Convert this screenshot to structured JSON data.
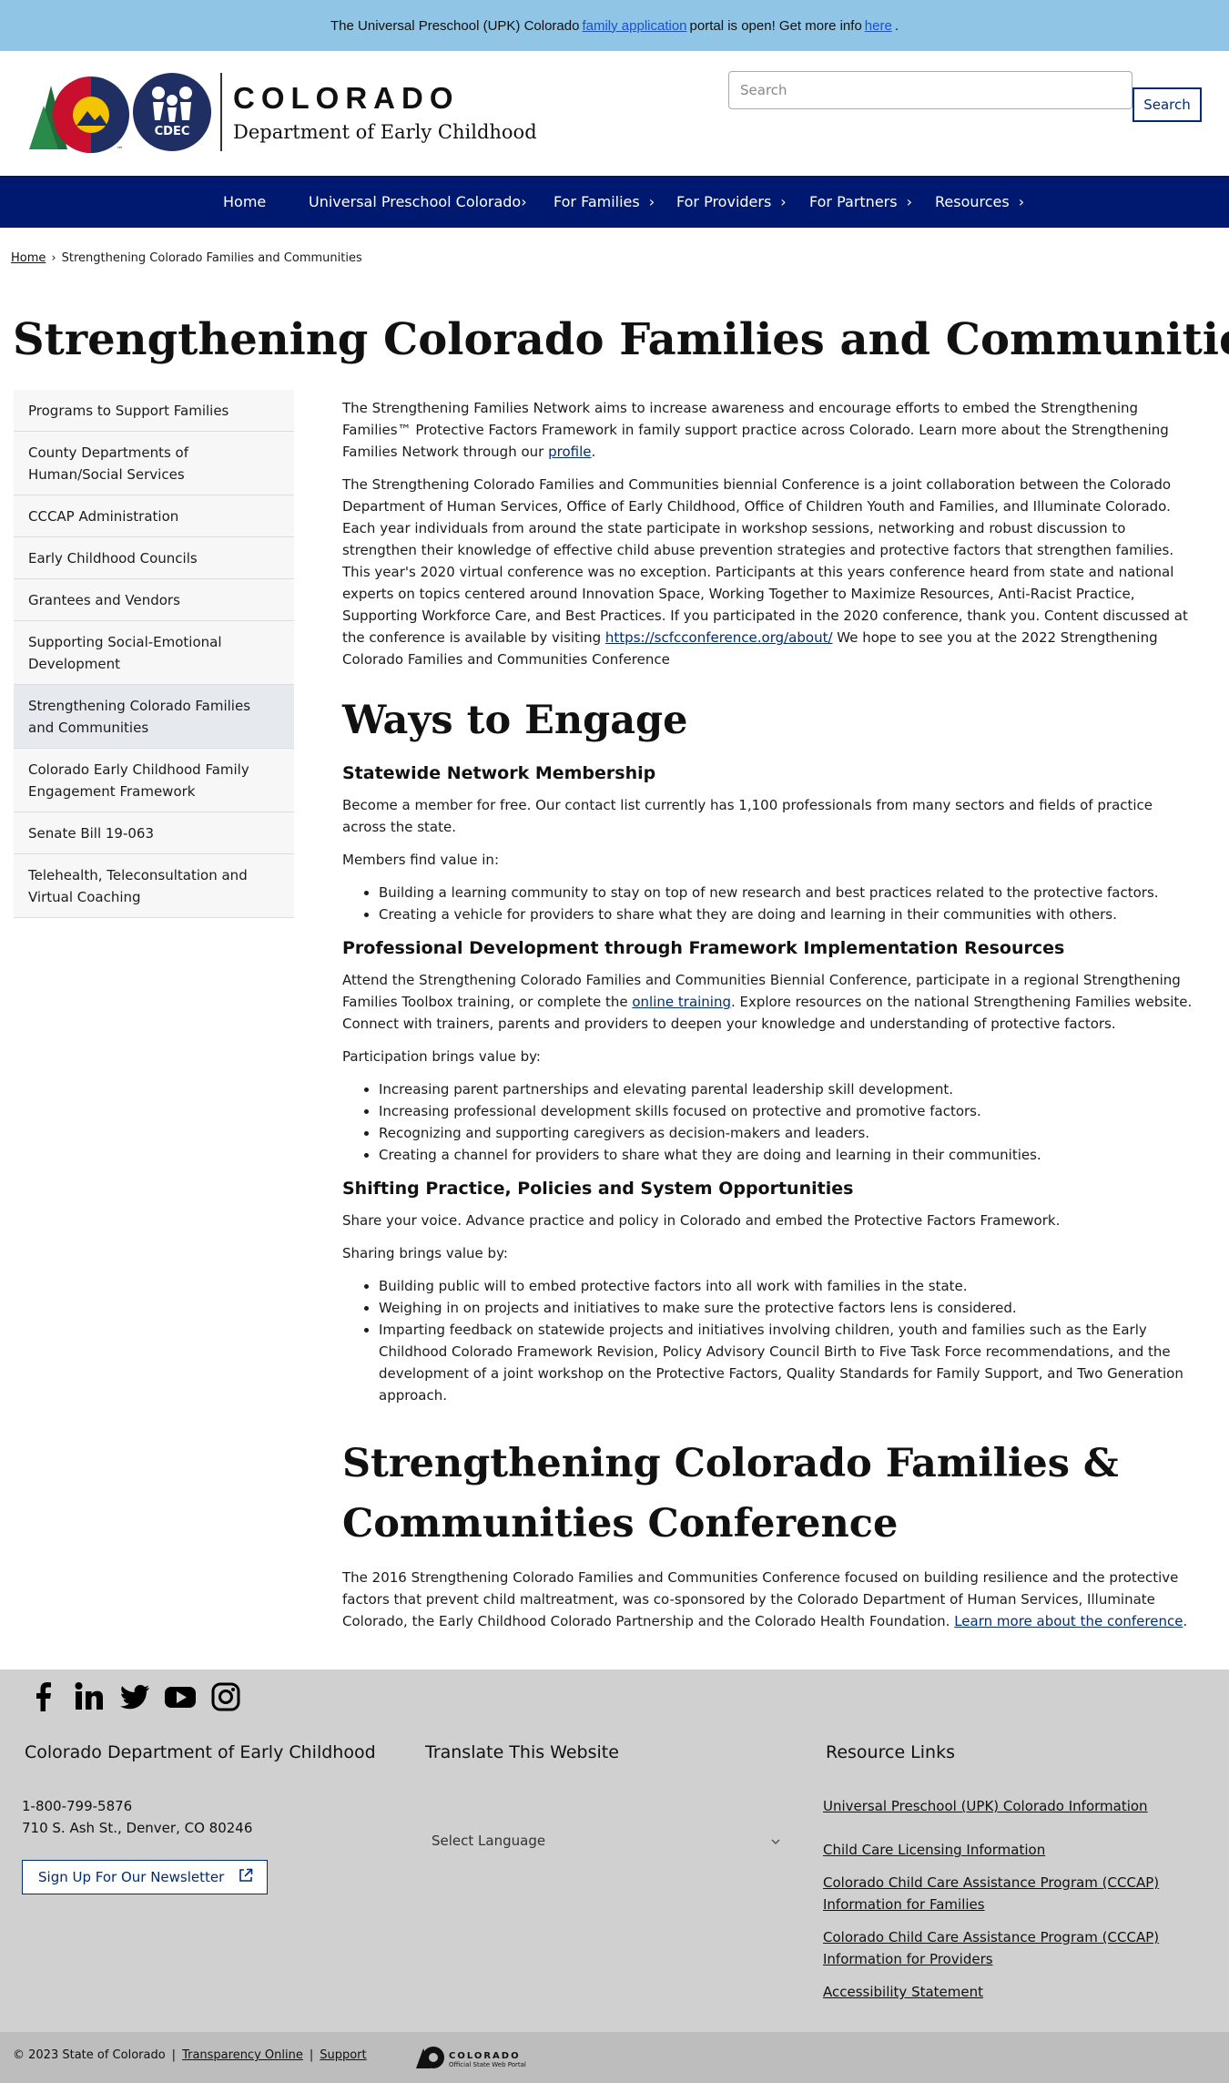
{
  "alert": {
    "text_before": "The Universal Preschool (UPK) Colorado",
    "link1": "family application",
    "text_middle": "portal is open! Get more info",
    "link2": "here",
    "text_end": "."
  },
  "header": {
    "logo_word1": "COLORADO",
    "logo_word2": "Department of Early Childhood",
    "logo_badge": "CDEC",
    "search_placeholder": "Search",
    "search_button": "Search"
  },
  "nav": {
    "items": [
      {
        "label": "Home"
      },
      {
        "label": "Universal Preschool Colorado"
      },
      {
        "label": "For Families"
      },
      {
        "label": "For Providers"
      },
      {
        "label": "For Partners"
      },
      {
        "label": "Resources"
      }
    ],
    "chevron": "›"
  },
  "breadcrumb": {
    "home": "Home",
    "separator": "›",
    "current": "Strengthening Colorado Families and Communities"
  },
  "page_title": "Strengthening Colorado Families and Communities",
  "sidebar": {
    "items": [
      {
        "label": "Programs to Support Families"
      },
      {
        "label": "County Departments of Human/Social Services"
      },
      {
        "label": "CCCAP Administration"
      },
      {
        "label": "Early Childhood Councils"
      },
      {
        "label": "Grantees and Vendors"
      },
      {
        "label": "Supporting Social-Emotional Development"
      },
      {
        "label": "Strengthening Colorado Families and Communities"
      },
      {
        "label": "Colorado Early Childhood Family Engagement Framework"
      },
      {
        "label": "Senate Bill 19-063"
      },
      {
        "label": "Telehealth, Teleconsultation and Virtual Coaching"
      }
    ]
  },
  "main": {
    "intro1_text": "The Strengthening Families Network aims to increase awareness and encourage efforts to embed the Strengthening Families™ Protective Factors Framework in family support practice across Colorado. Learn more about the Strengthening Families Network through our ",
    "intro1_link": "profile",
    "intro1_end": ".",
    "intro2_text": "The Strengthening Colorado Families and Communities biennial Conference is a joint collaboration between the Colorado Department of Human Services, Office of Early Childhood, Office of  Children Youth and Families, and Illuminate Colorado.  Each year individuals from around the state participate in workshop sessions, networking and robust discussion to strengthen their knowledge of effective child abuse prevention strategies and protective factors that strengthen families. This year's 2020 virtual conference was no exception. Participants at this years conference heard from state and national experts on topics centered around Innovation Space, Working Together to Maximize Resources, Anti-Racist Practice, Supporting Workforce Care, and Best Practices. If you participated in the 2020 conference, thank you. Content discussed at the conference is available by visiting ",
    "intro2_link": "https://scfcconference.org/about/",
    "intro2_end": " We hope to see you at the 2022 Strengthening Colorado Families and Communities Conference",
    "ways_heading": "Ways to Engage",
    "s1_heading": "Statewide Network Membership",
    "s1_p1": "Become a member for free. Our contact list currently has 1,100 professionals from many sectors and fields of practice across the state.",
    "s1_p2": "Members find value in:",
    "s1_list": [
      "Building a learning community to stay on top of new research and best practices related to the protective factors.",
      "Creating a vehicle for providers to share what they are doing and learning in their communities with others."
    ],
    "s2_heading": "Professional Development through Framework Implementation Resources",
    "s2_p1_a": "Attend the Strengthening Colorado Families and Communities Biennial Conference, participate in a regional Strengthening Families Toolbox training, or complete the ",
    "s2_p1_link": "online training",
    "s2_p1_b": ". Explore resources on the national Strengthening Families website. Connect with trainers, parents and providers to deepen your knowledge and understanding of protective factors.",
    "s2_p2": "Participation brings value by:",
    "s2_list": [
      "Increasing parent partnerships and elevating parental leadership skill development.",
      "Increasing professional development skills focused on protective and promotive factors.",
      "Recognizing and supporting caregivers as decision-makers and leaders.",
      "Creating a channel for providers to share what they are doing and learning in their communities."
    ],
    "s3_heading": "Shifting Practice, Policies and System Opportunities",
    "s3_p1": "Share your voice. Advance practice and policy in Colorado and embed the Protective Factors Framework.",
    "s3_p2": "Sharing brings value by:",
    "s3_list": [
      "Building public will to embed protective factors into all work with families in the state.",
      "Weighing in on projects and initiatives to make sure the protective factors lens is considered.",
      "Imparting feedback on statewide projects and initiatives involving children, youth and families such as the Early Childhood Colorado Framework Revision, Policy Advisory Council Birth to Five Task Force recommendations, and the development of a joint workshop on the Protective Factors, Quality Standards for Family Support, and Two Generation approach."
    ],
    "conf_heading": "Strengthening Colorado Families & Communities Conference",
    "conf_p_a": "The 2016 Strengthening Colorado Families and Communities Conference focused on building resilience and the protective factors that prevent child maltreatment, was co-sponsored by the Colorado Department of Human Services, Illuminate Colorado, the Early Childhood Colorado Partnership and the Colorado Health Foundation. ",
    "conf_link": "Learn more about the conference",
    "conf_p_end": "."
  },
  "footer": {
    "col1_title": "Colorado Department of Early Childhood",
    "phone": "1-800-799-5876",
    "address": "710 S. Ash St., Denver, CO 80246",
    "newsletter": "Sign Up For Our Newsletter",
    "col2_title": "Translate This Website",
    "language_select": "Select Language",
    "col3_title": "Resource Links",
    "resource_links": [
      "Universal Preschool (UPK) Colorado Information",
      "Child Care Licensing Information",
      "Colorado Child Care Assistance Program (CCCAP) Information for Families",
      "Colorado Child Care Assistance Program (CCCAP) Information for Providers",
      "Accessibility Statement"
    ],
    "social_icons": [
      "facebook-icon",
      "linkedin-icon",
      "twitter-icon",
      "youtube-icon",
      "instagram-icon"
    ]
  },
  "subfooter": {
    "copyright": "© 2023 State of Colorado",
    "sep": "|",
    "transparency": "Transparency Online",
    "support": "Support",
    "portal_word": "COLORADO",
    "portal_sub": "Official State Web Portal"
  },
  "colors": {
    "alert_bg": "#90c5e5",
    "nav_bg": "#001970",
    "link": "#002d72",
    "footer_bg": "#d0d0d0"
  }
}
